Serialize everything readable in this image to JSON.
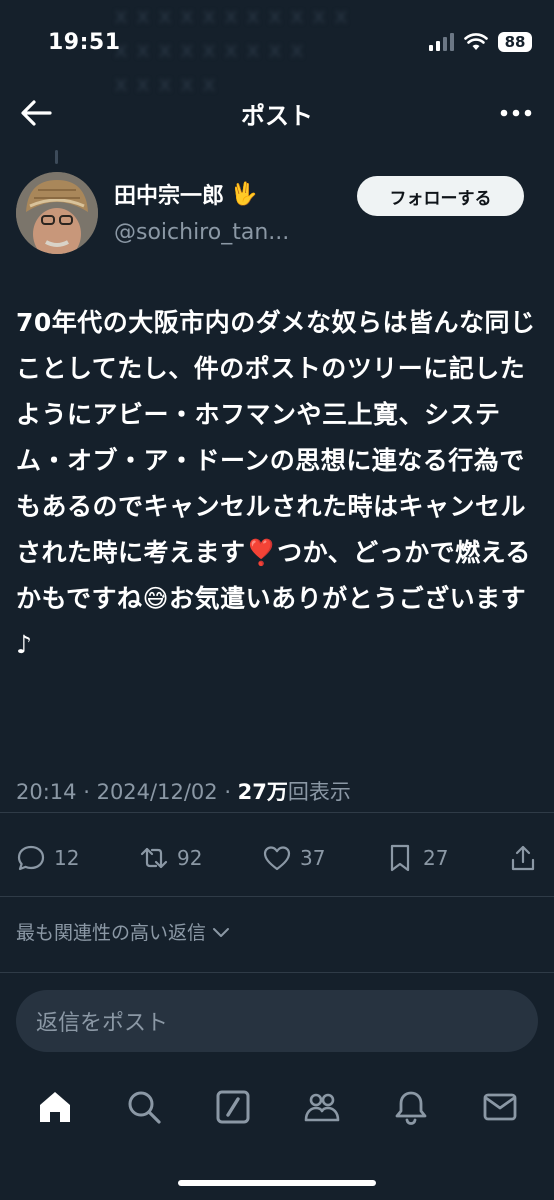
{
  "status_bar": {
    "time": "19:51",
    "battery": "88"
  },
  "header": {
    "title": "ポスト"
  },
  "author": {
    "name": "田中宗一郎",
    "name_emoji": "🖖",
    "handle": "@soichiro_tan..."
  },
  "follow_label": "フォローする",
  "tweet": {
    "text": "70年代の大阪市内のダメな奴らは皆んな同じことしてたし、件のポストのツリーに記したようにアビー・ホフマンや三上寛、システム・オブ・ア・ドーンの思想に連なる行為でもあるのでキャンセルされた時はキャンセルされた時に考えます❣️つか、どっかで燃えるかもですね😅お気遣いありがとうございます♪"
  },
  "meta": {
    "time": "20:14",
    "date": "2024/12/02",
    "views_count": "27万",
    "views_label": "回表示"
  },
  "actions": {
    "replies": "12",
    "reposts": "92",
    "likes": "37",
    "bookmarks": "27"
  },
  "sort_label": "最も関連性の高い返信",
  "reply_placeholder": "返信をポスト",
  "colors": {
    "background": "#15202b",
    "secondary_text": "#8b98a5",
    "follow_button": "#eff3f4",
    "reply_field": "#273340"
  }
}
